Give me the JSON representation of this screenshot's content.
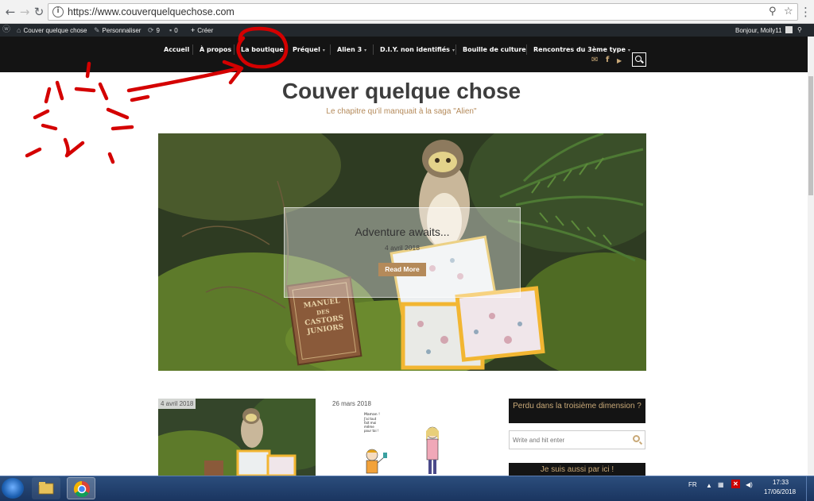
{
  "browser": {
    "url": "https://www.couverquelquechose.com",
    "back_icon": "arrow-left-icon",
    "forward_icon": "arrow-right-icon",
    "reload_icon": "reload-icon"
  },
  "adminbar": {
    "site_name": "Couver quelque chose",
    "customize": "Personnaliser",
    "updates_count": "9",
    "comments_count": "0",
    "create": "Créer",
    "greeting": "Bonjour, Molly11"
  },
  "nav": {
    "items": [
      {
        "label": "Accueil",
        "has_sub": false
      },
      {
        "label": "À propos",
        "has_sub": false
      },
      {
        "label": "La boutique",
        "has_sub": false
      },
      {
        "label": "Préquel",
        "has_sub": true
      },
      {
        "label": "Alien 3",
        "has_sub": true
      },
      {
        "label": "D.I.Y. non identifiés",
        "has_sub": true
      },
      {
        "label": "Bouille de culture",
        "has_sub": false
      },
      {
        "label": "Rencontres du 3ème type",
        "has_sub": true
      }
    ],
    "chevron": "▾",
    "social": {
      "mail": "✉",
      "facebook": "f",
      "youtube": "▶"
    }
  },
  "site": {
    "title": "Couver quelque chose",
    "tagline": "Le chapitre qu'il manquait à la saga \"Alien\""
  },
  "hero": {
    "title": "Adventure awaits...",
    "date": "4 avril 2018",
    "button": "Read More",
    "book_line1": "MANUEL",
    "book_line2": "DES",
    "book_line3": "CASTORS",
    "book_line4": "JUNIORS"
  },
  "posts": [
    {
      "date": "4 avril 2018"
    },
    {
      "date": "26 mars 2018"
    }
  ],
  "comic": {
    "bubble_line1": "Maman !",
    "bubble_line2": "J'ai tout",
    "bubble_line3": "fait moi",
    "bubble_line4": "même",
    "bubble_line5": "pour toi !"
  },
  "sidebar": {
    "widget1_title": "Perdu dans la troisième dimension ?",
    "search_placeholder": "Write and hit enter",
    "widget2_title": "Je suis aussi par ici !"
  },
  "taskbar": {
    "language": "FR",
    "time": "17:33",
    "date": "17/06/2018"
  },
  "colors": {
    "accent": "#b48a5a",
    "nav_bg": "#141414",
    "annotation": "#d40000"
  }
}
